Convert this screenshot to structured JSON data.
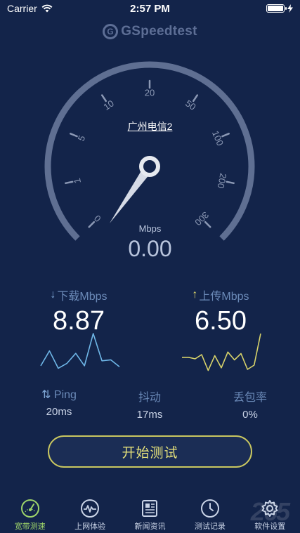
{
  "status_bar": {
    "carrier": "Carrier",
    "time": "2:57 PM",
    "battery_percent": 100
  },
  "app": {
    "logo_text": "GSpeedtest",
    "logo_icon": "g-speedometer-logo"
  },
  "gauge": {
    "tick_labels": [
      "0",
      "1",
      "5",
      "10",
      "20",
      "50",
      "100",
      "200",
      "300"
    ],
    "server": "广州电信2",
    "unit": "Mbps",
    "value": "0.00"
  },
  "download": {
    "label": "下载Mbps",
    "value": "8.87",
    "icon": "arrow-down-icon",
    "line_color": "#6fb7e8",
    "spark": [
      2,
      5,
      1.5,
      2.5,
      4.5,
      2,
      8.5,
      3,
      3.2,
      1.8
    ]
  },
  "upload": {
    "label": "上传Mbps",
    "value": "6.50",
    "icon": "arrow-up-icon",
    "line_color": "#d8d36a",
    "spark": [
      3.5,
      3.5,
      3.2,
      4,
      1,
      3.8,
      1.5,
      4.5,
      3,
      4.2,
      1.2,
      2,
      8
    ]
  },
  "stats": {
    "ping_label": "Ping",
    "ping_value": "20ms",
    "jitter_label": "抖动",
    "jitter_value": "17ms",
    "loss_label": "丢包率",
    "loss_value": "0%"
  },
  "start_button": {
    "label": "开始测试",
    "border_color": "#c9c760"
  },
  "tabs": [
    {
      "label": "宽带测速",
      "icon": "speedometer-icon",
      "active": true
    },
    {
      "label": "上网体验",
      "icon": "pulse-icon",
      "active": false
    },
    {
      "label": "新闻资讯",
      "icon": "newspaper-icon",
      "active": false
    },
    {
      "label": "测试记录",
      "icon": "clock-icon",
      "active": false
    },
    {
      "label": "软件设置",
      "icon": "gear-icon",
      "active": false
    }
  ],
  "watermark": "265"
}
